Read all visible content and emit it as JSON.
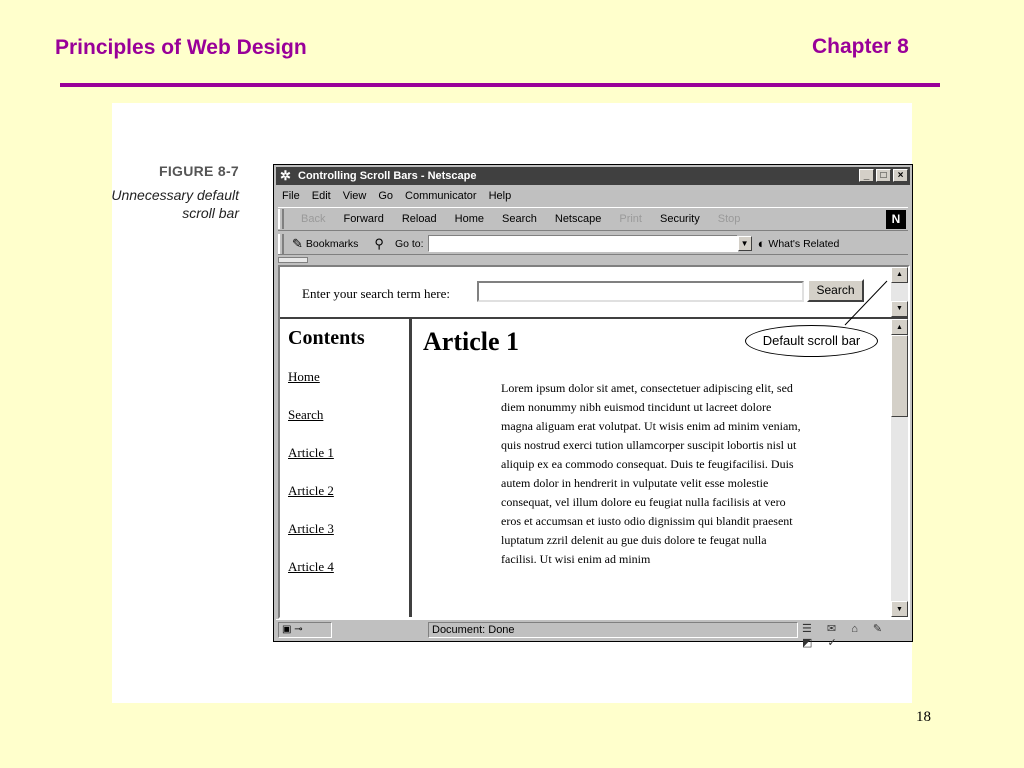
{
  "slide": {
    "title": "Principles of Web Design",
    "chapter": "Chapter 8",
    "page_number": "18",
    "accent_color": "#990099",
    "background": "#ffffcc"
  },
  "figure": {
    "number": "FIGURE 8-7",
    "caption": "Unnecessary default scroll bar",
    "callout": "Default scroll bar"
  },
  "browser": {
    "title": "Controlling Scroll Bars - Netscape",
    "window_buttons": [
      "_",
      "□",
      "×"
    ],
    "menu": [
      "File",
      "Edit",
      "View",
      "Go",
      "Communicator",
      "Help"
    ],
    "toolbar": [
      {
        "label": "Back",
        "enabled": false
      },
      {
        "label": "Forward",
        "enabled": true
      },
      {
        "label": "Reload",
        "enabled": true
      },
      {
        "label": "Home",
        "enabled": true
      },
      {
        "label": "Search",
        "enabled": true
      },
      {
        "label": "Netscape",
        "enabled": true
      },
      {
        "label": "Print",
        "enabled": false
      },
      {
        "label": "Security",
        "enabled": true
      },
      {
        "label": "Stop",
        "enabled": false
      }
    ],
    "logo": "N",
    "bookmarks_label": "Bookmarks",
    "goto_label": "Go to:",
    "location_value": "",
    "whats_related": "What's Related",
    "status_text": "Document: Done"
  },
  "page": {
    "search_label": "Enter your search term here:",
    "search_value": "",
    "search_button": "Search",
    "nav_title": "Contents",
    "nav_links": [
      "Home",
      "Search",
      "Article 1",
      "Article 2",
      "Article 3",
      "Article 4"
    ],
    "article_title": "Article 1",
    "article_text": "Lorem ipsum dolor sit amet, consectetuer adipiscing elit, sed diem nonummy nibh euismod tincidunt ut lacreet dolore magna aliguam erat volutpat. Ut wisis enim ad minim veniam, quis nostrud exerci tution ullamcorper suscipit lobortis nisl ut aliquip ex ea commodo consequat. Duis te feugifacilisi. Duis autem dolor in hendrerit in vulputate velit esse molestie consequat, vel illum dolore eu feugiat nulla facilisis at vero eros et accumsan et iusto odio dignissim qui blandit praesent luptatum zzril delenit au gue duis dolore te feugat nulla facilisi. Ut wisi enim ad minim"
  }
}
